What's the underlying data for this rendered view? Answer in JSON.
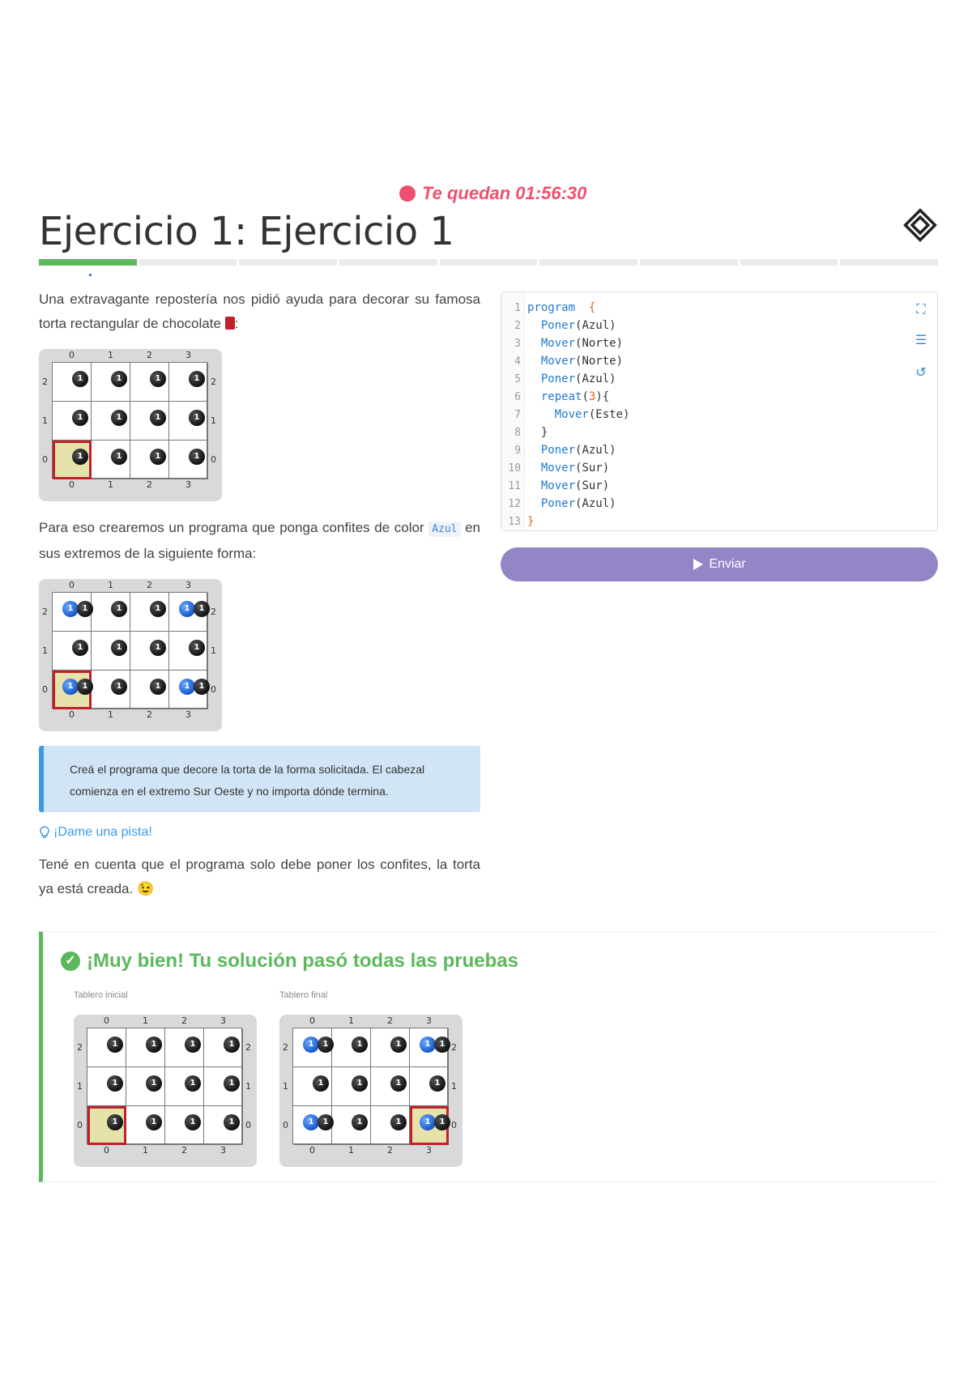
{
  "timer": {
    "text": "Te quedan 01:56:30"
  },
  "title": "Ejercicio 1: Ejercicio 1",
  "progress": {
    "total": 9,
    "done": 1
  },
  "intro": {
    "p1_a": "Una extravagante repostería nos pidió ayuda para decorar su famosa torta rectangular de chocolate ",
    "p1_b": ":",
    "p2_a": "Para eso crearemos un programa que ponga confites de color ",
    "p2_code": "Azul",
    "p2_b": " en sus extremos de la siguiente forma:",
    "note": "Creá el programa que decore la torta de la forma solicitada. El cabezal comienza en el extremo Sur Oeste y no importa dónde termina.",
    "hint": "¡Dame una pista!",
    "p3": "Tené en cuenta que el programa solo debe poner los confites, la torta ya está creada. 😉"
  },
  "boards": {
    "cols": [
      "0",
      "1",
      "2",
      "3"
    ],
    "rows": [
      "2",
      "1",
      "0"
    ],
    "ball_label": "1"
  },
  "editor": {
    "lines": [
      {
        "n": "1",
        "parts": [
          [
            "kw",
            "program"
          ],
          [
            "",
            "  "
          ],
          [
            "br",
            "{"
          ]
        ]
      },
      {
        "n": "2",
        "parts": [
          [
            "",
            "  "
          ],
          [
            "fn",
            "Poner"
          ],
          [
            "",
            "(Azul)"
          ]
        ]
      },
      {
        "n": "3",
        "parts": [
          [
            "",
            "  "
          ],
          [
            "fn",
            "Mover"
          ],
          [
            "",
            "(Norte)"
          ]
        ]
      },
      {
        "n": "4",
        "parts": [
          [
            "",
            "  "
          ],
          [
            "fn",
            "Mover"
          ],
          [
            "",
            "(Norte)"
          ]
        ]
      },
      {
        "n": "5",
        "parts": [
          [
            "",
            "  "
          ],
          [
            "fn",
            "Poner"
          ],
          [
            "",
            "(Azul)"
          ]
        ]
      },
      {
        "n": "6",
        "parts": [
          [
            "",
            "  "
          ],
          [
            "kw",
            "repeat"
          ],
          [
            "",
            "("
          ],
          [
            "num",
            "3"
          ],
          [
            "",
            ")"
          ],
          [
            "",
            "{"
          ]
        ]
      },
      {
        "n": "7",
        "parts": [
          [
            "",
            "    "
          ],
          [
            "fn",
            "Mover"
          ],
          [
            "",
            "(Este)"
          ]
        ]
      },
      {
        "n": "8",
        "parts": [
          [
            "",
            "  }"
          ]
        ]
      },
      {
        "n": "9",
        "parts": [
          [
            "",
            "  "
          ],
          [
            "fn",
            "Poner"
          ],
          [
            "",
            "(Azul)"
          ]
        ]
      },
      {
        "n": "10",
        "parts": [
          [
            "",
            "  "
          ],
          [
            "fn",
            "Mover"
          ],
          [
            "",
            "(Sur)"
          ]
        ]
      },
      {
        "n": "11",
        "parts": [
          [
            "",
            "  "
          ],
          [
            "fn",
            "Mover"
          ],
          [
            "",
            "(Sur)"
          ]
        ]
      },
      {
        "n": "12",
        "parts": [
          [
            "",
            "  "
          ],
          [
            "fn",
            "Poner"
          ],
          [
            "",
            "(Azul)"
          ]
        ]
      },
      {
        "n": "13",
        "parts": [
          [
            "br",
            "}"
          ]
        ]
      }
    ]
  },
  "send_label": "Enviar",
  "result": {
    "title": "¡Muy bien! Tu solución pasó todas las pruebas",
    "initial_label": "Tablero inicial",
    "final_label": "Tablero final"
  }
}
